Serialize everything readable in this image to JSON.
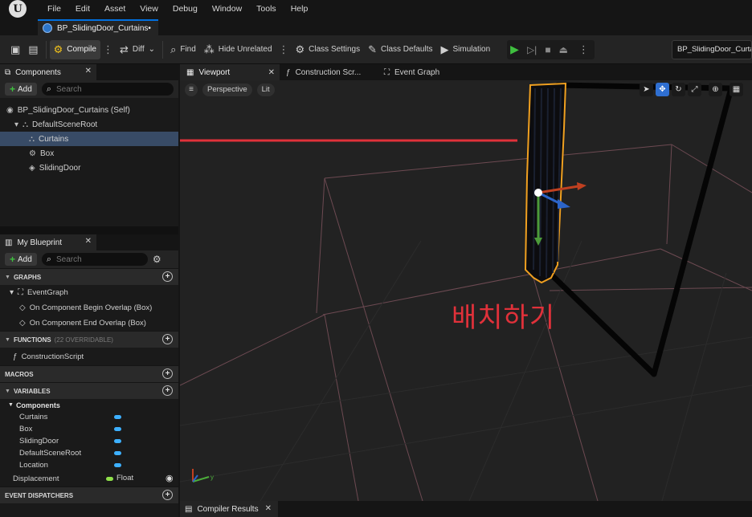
{
  "menu": [
    "File",
    "Edit",
    "Asset",
    "View",
    "Debug",
    "Window",
    "Tools",
    "Help"
  ],
  "logo_icon": "unreal-logo-icon",
  "document_tab": "BP_SlidingDoor_Curtains•",
  "toolbar": {
    "compile": "Compile",
    "diff": "Diff",
    "find": "Find",
    "hide_unrelated": "Hide Unrelated",
    "class_settings": "Class Settings",
    "class_defaults": "Class Defaults",
    "simulation": "Simulation",
    "debug_object": "BP_SlidingDoor_Curta"
  },
  "components_panel": {
    "title": "Components",
    "add": "Add",
    "search_placeholder": "Search",
    "tree": {
      "root": "BP_SlidingDoor_Curtains (Self)",
      "scene_root": "DefaultSceneRoot",
      "curtains": "Curtains",
      "box": "Box",
      "sliding_door": "SlidingDoor"
    }
  },
  "my_blueprint": {
    "title": "My Blueprint",
    "add": "Add",
    "search_placeholder": "Search",
    "graphs": "GRAPHS",
    "event_graph": "EventGraph",
    "begin_overlap": "On Component Begin Overlap (Box)",
    "end_overlap": "On Component End Overlap (Box)",
    "functions": "FUNCTIONS",
    "functions_sub": "(22 OVERRIDABLE)",
    "construction_script": "ConstructionScript",
    "macros": "MACROS",
    "variables": "VARIABLES",
    "components_header": "Components",
    "vars": [
      "Curtains",
      "Box",
      "SlidingDoor",
      "DefaultSceneRoot",
      "Location"
    ],
    "displacement": "Displacement",
    "displacement_type": "Float",
    "event_dispatchers": "EVENT DISPATCHERS"
  },
  "center_tabs": {
    "viewport": "Viewport",
    "construction": "Construction Scr...",
    "event_graph": "Event Graph"
  },
  "viewport": {
    "perspective": "Perspective",
    "lit": "Lit",
    "annotation": "배치하기",
    "annotation_color": "#e0313a",
    "selection_color": "#f0a020"
  },
  "bottom": {
    "compiler_results": "Compiler Results"
  }
}
